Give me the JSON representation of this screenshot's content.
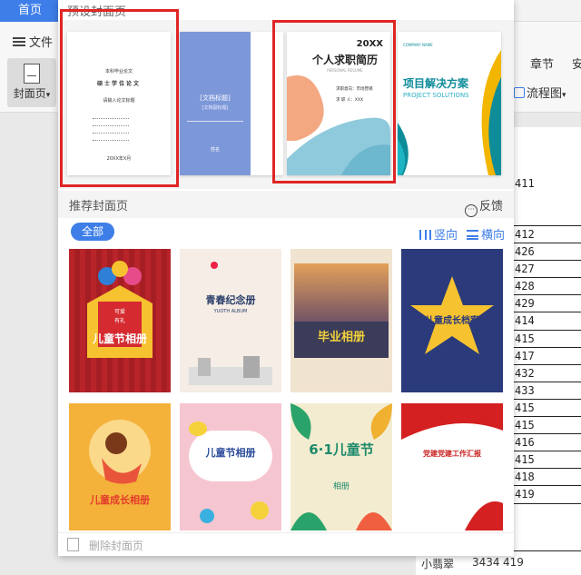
{
  "app": {
    "tab_home": "首页",
    "file_menu": "文件",
    "cover_button": "封面页",
    "cover_button_arrow": "▾",
    "chapter_tab": "章节",
    "security_tab_partial": "安",
    "flowchart": "流程图",
    "flowchart_arrow": "▾",
    "colors": {
      "accent": "#3e7ee8",
      "highlight": "#e02525"
    }
  },
  "table_cells": [
    "411",
    "412",
    "426",
    "427",
    "428",
    "429",
    "414",
    "415",
    "417",
    "432",
    "433",
    "415",
    "415",
    "416",
    "415",
    "418",
    "419"
  ],
  "bottom_row": {
    "name": "小翡翠",
    "value": "3434",
    "trailing": "419"
  },
  "panel": {
    "preset_title": "预设封面页",
    "preset_cards": [
      {
        "id": "thesis",
        "lines": [
          "本科毕业论文",
          "硕士学位论文",
          "请输入论文标题",
          "20XX年X月"
        ]
      },
      {
        "id": "blue",
        "title": "[文档标题]",
        "subtitle": "[文档副标题]",
        "small": "姓名"
      },
      {
        "id": "resume",
        "year": "20XX",
        "title": "个人求职简历",
        "subtitle": "PERSONAL RESUME",
        "line1": "求职意向：市场营销",
        "line2": "求 职 人：XXX"
      },
      {
        "id": "project",
        "company": "COMPANY NAME",
        "title": "项目解决方案",
        "subtitle": "PROJECT SOLUTIONS"
      }
    ],
    "recommended_title": "推荐封面页",
    "feedback": "反馈",
    "feedback_icon": "speech-bubble",
    "filter_all": "全部",
    "orientation_vertical": "竖向",
    "orientation_horizontal": "横向",
    "templates_row1": [
      {
        "title": "儿童节相册",
        "badge_top": "可爱",
        "badge_bottom": "有礼",
        "bg": "#b8242a"
      },
      {
        "title": "青春纪念册",
        "subtitle": "YUOTH ALBUM",
        "bg": "#f5ede6"
      },
      {
        "title": "毕业相册",
        "bg": "#6b4a8c"
      },
      {
        "title": "儿童成长档案",
        "bg": "#2a3a7a"
      }
    ],
    "templates_row2": [
      {
        "title": "儿童成长相册",
        "bg": "#f4b23b"
      },
      {
        "title": "儿童节相册",
        "bg": "#f6c6d0"
      },
      {
        "title": "6·1儿童节",
        "sub": "相册",
        "bg": "#f3ecd0"
      },
      {
        "title": "党建党建工作汇报",
        "bg": "#fff"
      }
    ],
    "delete_label": "删除封面页"
  }
}
